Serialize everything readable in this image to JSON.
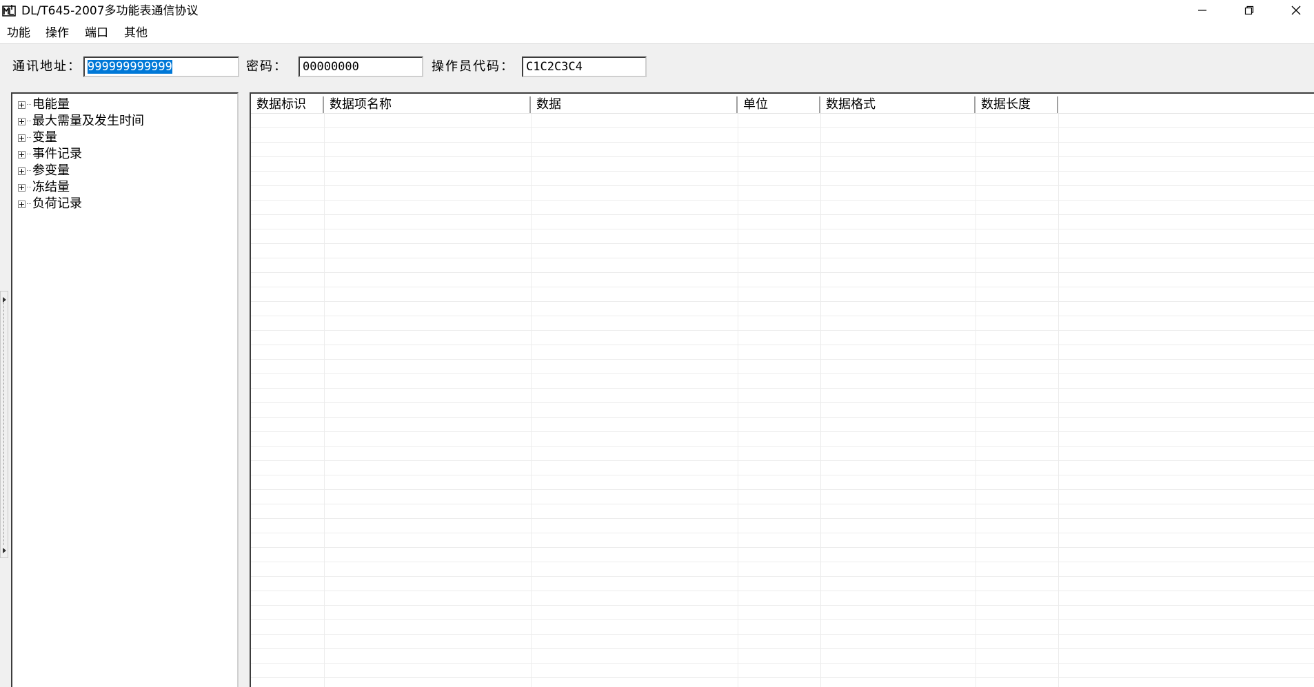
{
  "window": {
    "title": "DL/T645-2007多功能表通信协议",
    "icon": "app-icon",
    "controls": [
      "minimize-icon",
      "maximize-icon",
      "close-icon"
    ]
  },
  "menu": {
    "items": [
      "功能",
      "操作",
      "端口",
      "其他"
    ]
  },
  "toolbar": {
    "address_label": "通讯地址：",
    "address_value": "999999999999",
    "password_label": "密码：",
    "password_value": "00000000",
    "operator_label": "操作员代码：",
    "operator_value": "C1C2C3C4"
  },
  "tree": {
    "items": [
      "电能量",
      "最大需量及发生时间",
      "变量",
      "事件记录",
      "参变量",
      "冻结量",
      "负荷记录"
    ]
  },
  "table": {
    "columns": [
      "数据标识",
      "数据项名称",
      "数据",
      "单位",
      "数据格式",
      "数据长度"
    ],
    "rows": []
  },
  "colors": {
    "selection": "#0078d7",
    "background": "#f0f0f0"
  }
}
